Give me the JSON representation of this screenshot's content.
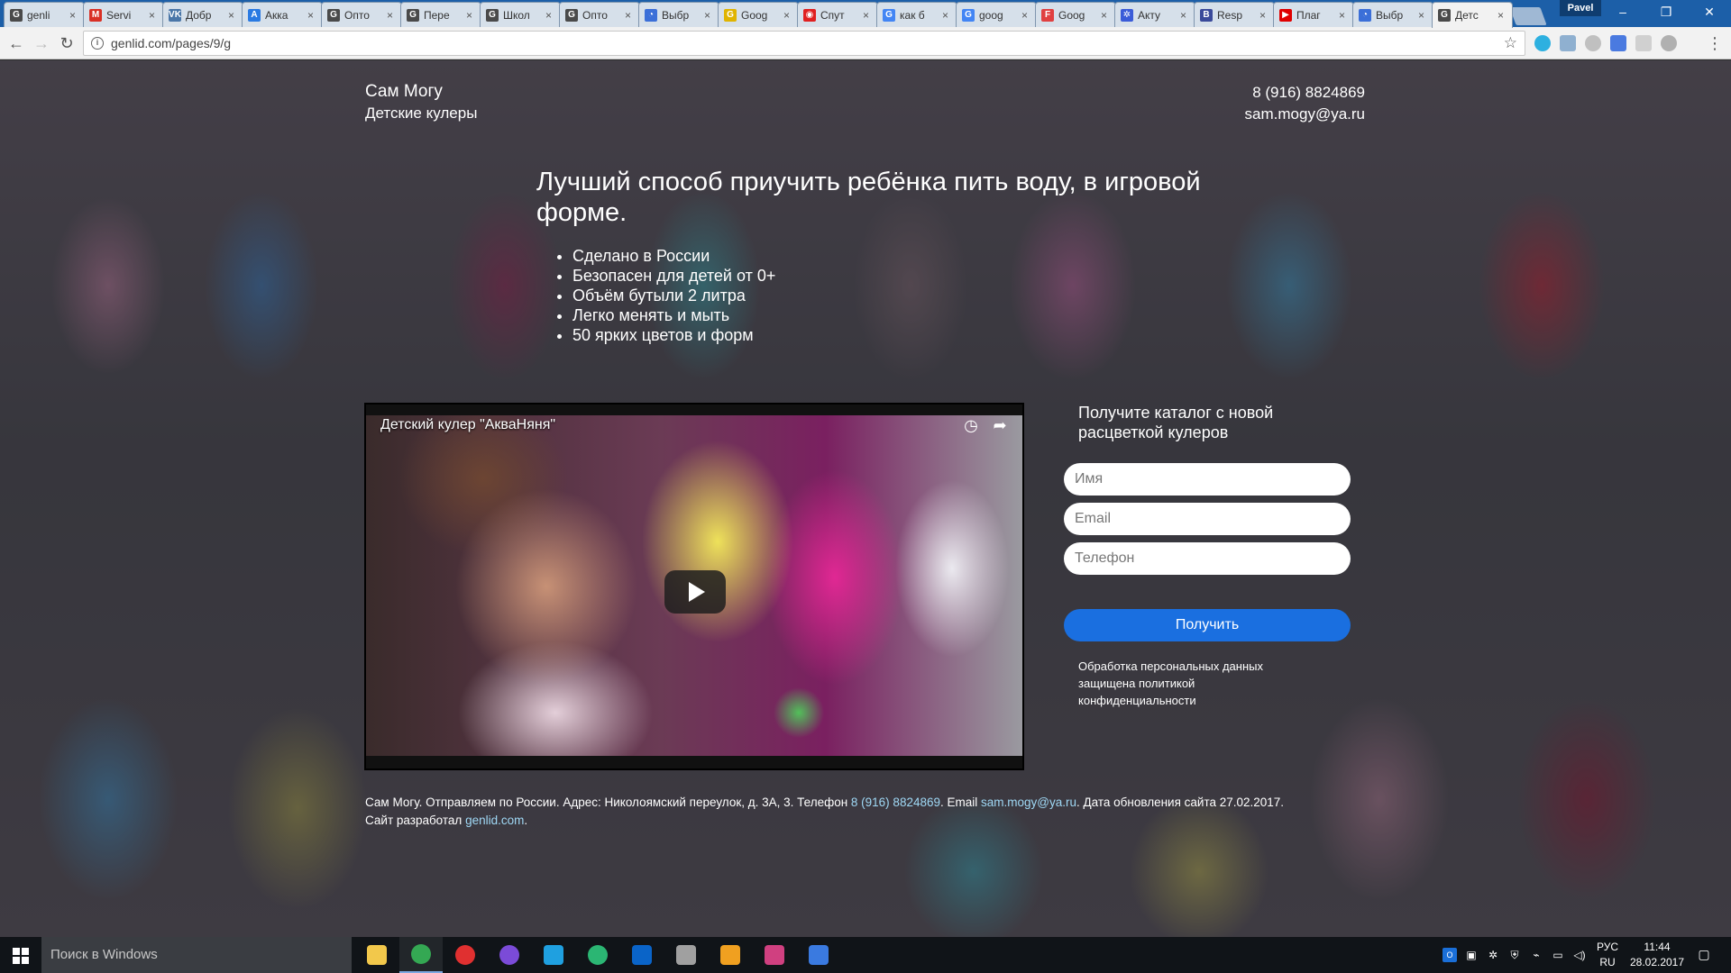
{
  "browser": {
    "tabs": [
      {
        "title": "genli",
        "color": "#4a4a4a",
        "glyph": "G"
      },
      {
        "title": "Servi",
        "color": "#d93025",
        "glyph": "M"
      },
      {
        "title": "Добр",
        "color": "#4a76a8",
        "glyph": "VK"
      },
      {
        "title": "Акка",
        "color": "#2a7ae2",
        "glyph": "A"
      },
      {
        "title": "Опто",
        "color": "#4a4a4a",
        "glyph": "G"
      },
      {
        "title": "Пере",
        "color": "#4a4a4a",
        "glyph": "G"
      },
      {
        "title": "Школ",
        "color": "#4a4a4a",
        "glyph": "G"
      },
      {
        "title": "Опто",
        "color": "#4a4a4a",
        "glyph": "G"
      },
      {
        "title": "Выбр",
        "color": "#3b6fd8",
        "glyph": "◔"
      },
      {
        "title": "Goog",
        "color": "#e0b400",
        "glyph": "G"
      },
      {
        "title": "Спут",
        "color": "#e02020",
        "glyph": "◉"
      },
      {
        "title": "как б",
        "color": "#4285f4",
        "glyph": "G"
      },
      {
        "title": "goog",
        "color": "#4285f4",
        "glyph": "G"
      },
      {
        "title": "Goog",
        "color": "#e04040",
        "glyph": "F"
      },
      {
        "title": "Акту",
        "color": "#3a5bd8",
        "glyph": "✲"
      },
      {
        "title": "Resp",
        "color": "#3a4a9a",
        "glyph": "B"
      },
      {
        "title": "Плаг",
        "color": "#e00000",
        "glyph": "▶"
      },
      {
        "title": "Выбр",
        "color": "#3b6fd8",
        "glyph": "◔"
      },
      {
        "title": "Детс",
        "color": "#4a4a4a",
        "glyph": "G"
      }
    ],
    "close_glyph": "×",
    "profile_name": "Pavel",
    "url": "genlid.com/pages/9/g",
    "controls": {
      "minimize": "–",
      "maximize": "❐",
      "close": "✕"
    }
  },
  "site": {
    "brand_name": "Сам Могу",
    "brand_subtitle": "Детские кулеры",
    "phone": "8 (916) 8824869",
    "email": "sam.mogy@ya.ru",
    "headline": "Лучший способ приучить ребёнка пить воду, в игровой форме.",
    "features": [
      "Сделано в России",
      "Безопасен для детей от 0+",
      "Объём бутыли 2 литра",
      "Легко менять и мыть",
      "50 ярких цветов и форм"
    ],
    "video": {
      "title": "Детский кулер \"АкваНяня\""
    },
    "form": {
      "title": "Получите каталог с новой расцветкой кулеров",
      "name_placeholder": "Имя",
      "email_placeholder": "Email",
      "phone_placeholder": "Телефон",
      "submit_label": "Получить",
      "privacy_text": "Обработка персональных данных защищена политикой конфиденциальности"
    },
    "footer": {
      "part1": "Сам Могу. Отправляем по России. Адрес: Николоямский переулок, д. 3А, 3. Телефон ",
      "phone": "8 (916) 8824869",
      "part2": ". Email ",
      "email": "sam.mogy@ya.ru",
      "part3": ". Дата обновления сайта 27.02.2017. Сайт разработал ",
      "developer": "genlid.com",
      "part4": "."
    }
  },
  "taskbar": {
    "search_placeholder": "Поиск в Windows",
    "apps": [
      {
        "name": "file-explorer",
        "color": "#f2c84b"
      },
      {
        "name": "chrome",
        "color": "#34a853"
      },
      {
        "name": "record-app",
        "color": "#e03030"
      },
      {
        "name": "purple-app",
        "color": "#7b4bd8"
      },
      {
        "name": "edge-app",
        "color": "#1fa0e0"
      },
      {
        "name": "green-app",
        "color": "#2bb673"
      },
      {
        "name": "outlook",
        "color": "#0a64c8"
      },
      {
        "name": "network-app",
        "color": "#a0a0a0"
      },
      {
        "name": "photo-app",
        "color": "#f0a020"
      },
      {
        "name": "gift-app",
        "color": "#d04080"
      },
      {
        "name": "a-app",
        "color": "#3a7ae0"
      }
    ],
    "language_top": "РУС",
    "language_bottom": "RU",
    "time": "11:44",
    "date": "28.02.2017"
  }
}
